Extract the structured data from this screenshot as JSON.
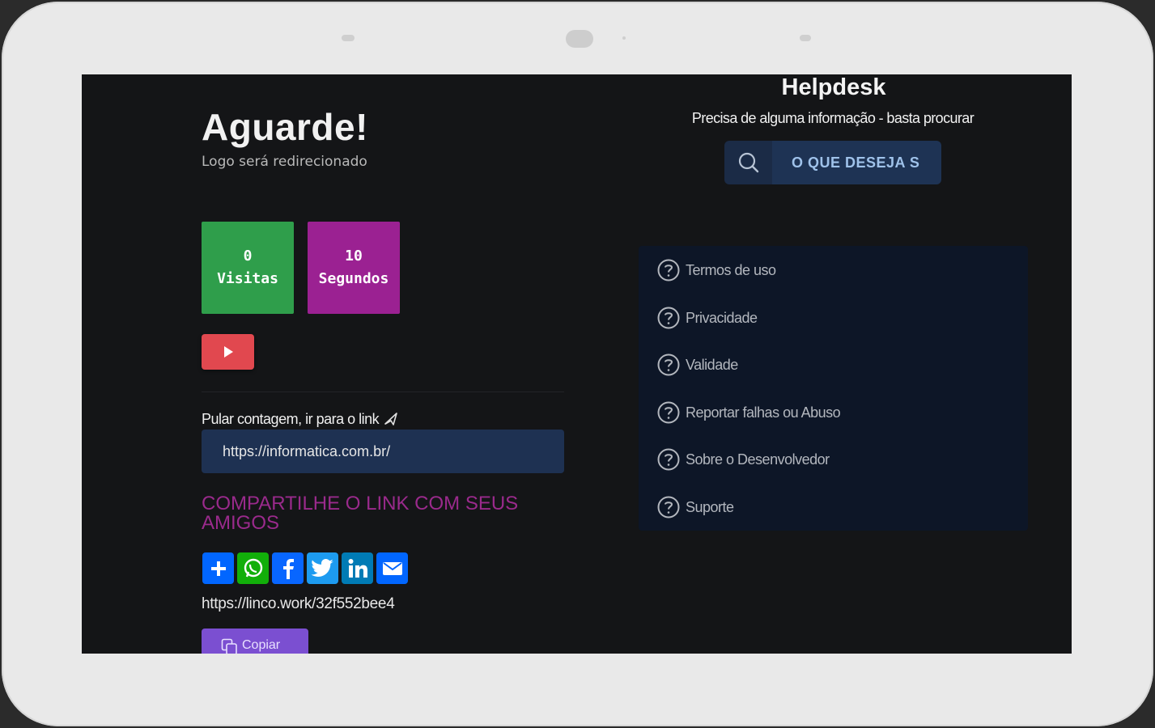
{
  "page": {
    "title": "Aguarde!",
    "subtitle": "Logo será redirecionado"
  },
  "stats": [
    {
      "value": "0",
      "label": "Visitas",
      "color": "#2f9e4b"
    },
    {
      "value": "10",
      "label": "Segundos",
      "color": "#9b2192"
    }
  ],
  "video_button": {
    "icon": "play-icon",
    "color": "#e1484f"
  },
  "skip": {
    "label": "Pular contagem, ir para o link",
    "icon": "rocket-icon",
    "url_value": "https://informatica.com.br/"
  },
  "share": {
    "title": "COMPARTILHE O LINK COM SEUS AMIGOS",
    "buttons": [
      {
        "name": "addtoany",
        "icon": "plus-icon",
        "color": "#0166ff"
      },
      {
        "name": "whatsapp",
        "icon": "whatsapp-icon",
        "color": "#12af0a"
      },
      {
        "name": "facebook",
        "icon": "facebook-icon",
        "color": "#0866ff"
      },
      {
        "name": "twitter",
        "icon": "twitter-icon",
        "color": "#1d9bf0"
      },
      {
        "name": "linkedin",
        "icon": "linkedin-icon",
        "color": "#007bb5"
      },
      {
        "name": "email",
        "icon": "email-icon",
        "color": "#0166ff"
      }
    ],
    "short_link": "https://linco.work/32f552bee4",
    "copy_label": "Copiar"
  },
  "helpdesk": {
    "title": "Helpdesk",
    "subtitle": "Precisa de alguma informação - basta procurar",
    "search_text": "O QUE DESEJA S",
    "menu": [
      {
        "label": "Termos de uso",
        "icon": "help-circle-icon"
      },
      {
        "label": "Privacidade",
        "icon": "help-circle-icon"
      },
      {
        "label": "Validade",
        "icon": "help-circle-icon"
      },
      {
        "label": "Reportar falhas ou Abuso",
        "icon": "help-circle-icon"
      },
      {
        "label": "Sobre o Desenvolvedor",
        "icon": "help-circle-icon"
      },
      {
        "label": "Suporte",
        "icon": "help-circle-icon"
      }
    ]
  }
}
